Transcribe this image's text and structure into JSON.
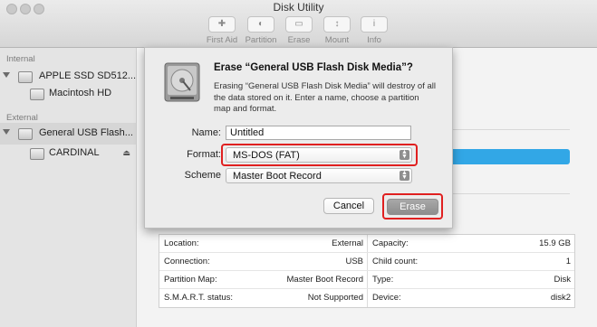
{
  "window": {
    "title": "Disk Utility"
  },
  "toolbar": {
    "items": [
      {
        "label": "First Aid",
        "glyph": "✚"
      },
      {
        "label": "Partition",
        "glyph": "◐"
      },
      {
        "label": "Erase",
        "glyph": "▭"
      },
      {
        "label": "Mount",
        "glyph": "↕"
      },
      {
        "label": "Info",
        "glyph": "i"
      }
    ]
  },
  "sidebar": {
    "internal_label": "Internal",
    "external_label": "External",
    "items": [
      {
        "label": "APPLE SSD SD512..."
      },
      {
        "label": "Macintosh HD"
      },
      {
        "label": "General USB Flash..."
      },
      {
        "label": "CARDINAL",
        "eject": "⏏"
      }
    ]
  },
  "background": {
    "partial_text": "l"
  },
  "dialog": {
    "title": "Erase “General USB Flash Disk Media”?",
    "description": "Erasing “General USB Flash Disk Media” will destroy of all the data stored on it. Enter a name, choose a partition map and format.",
    "name_label": "Name:",
    "name_value": "Untitled",
    "format_label": "Format:",
    "format_value": "MS-DOS (FAT)",
    "scheme_label": "Scheme",
    "scheme_value": "Master Boot Record",
    "cancel_label": "Cancel",
    "erase_label": "Erase"
  },
  "info": {
    "rows": [
      {
        "k1": "Location:",
        "v1": "External",
        "k2": "Capacity:",
        "v2": "15.9 GB"
      },
      {
        "k1": "Connection:",
        "v1": "USB",
        "k2": "Child count:",
        "v2": "1"
      },
      {
        "k1": "Partition Map:",
        "v1": "Master Boot Record",
        "k2": "Type:",
        "v2": "Disk"
      },
      {
        "k1": "S.M.A.R.T. status:",
        "v1": "Not Supported",
        "k2": "Device:",
        "v2": "disk2"
      }
    ]
  },
  "colors": {
    "highlight": "#e02020",
    "accent": "#32a7e6"
  }
}
